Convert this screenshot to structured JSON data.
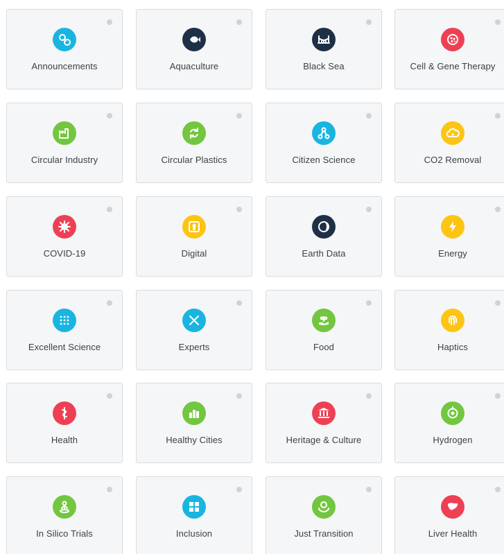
{
  "tiles": [
    {
      "label": "Announcements",
      "icon": "link-chain-icon",
      "color": "#19b5e0"
    },
    {
      "label": "Aquaculture",
      "icon": "fish-icon",
      "color": "#1e3046"
    },
    {
      "label": "Black Sea",
      "icon": "bridge-icon",
      "color": "#1e3046"
    },
    {
      "label": "Cell & Gene Therapy",
      "icon": "cell-icon",
      "color": "#ee4054"
    },
    {
      "label": "Circular Industry",
      "icon": "factory-icon",
      "color": "#73c63f"
    },
    {
      "label": "Circular Plastics",
      "icon": "recycle-icon",
      "color": "#73c63f"
    },
    {
      "label": "Citizen Science",
      "icon": "network-icon",
      "color": "#19b5e0"
    },
    {
      "label": "CO2 Removal",
      "icon": "cloud-co2-icon",
      "color": "#fdc513"
    },
    {
      "label": "COVID-19",
      "icon": "virus-icon",
      "color": "#ee4054"
    },
    {
      "label": "Digital",
      "icon": "keyhole-icon",
      "color": "#fdc513"
    },
    {
      "label": "Earth Data",
      "icon": "earth-icon",
      "color": "#1e3046"
    },
    {
      "label": "Energy",
      "icon": "lightning-icon",
      "color": "#fdc513"
    },
    {
      "label": "Excellent Science",
      "icon": "dots-grid-icon",
      "color": "#19b5e0"
    },
    {
      "label": "Experts",
      "icon": "tools-icon",
      "color": "#19b5e0"
    },
    {
      "label": "Food",
      "icon": "plant-hand-icon",
      "color": "#73c63f"
    },
    {
      "label": "Haptics",
      "icon": "fingerprint-icon",
      "color": "#fdc513"
    },
    {
      "label": "Health",
      "icon": "caduceus-icon",
      "color": "#ee4054"
    },
    {
      "label": "Healthy Cities",
      "icon": "city-icon",
      "color": "#73c63f"
    },
    {
      "label": "Heritage & Culture",
      "icon": "museum-icon",
      "color": "#ee4054"
    },
    {
      "label": "Hydrogen",
      "icon": "atom-target-icon",
      "color": "#73c63f"
    },
    {
      "label": "In Silico Trials",
      "icon": "person-pin-icon",
      "color": "#73c63f"
    },
    {
      "label": "Inclusion",
      "icon": "puzzle-icon",
      "color": "#19b5e0"
    },
    {
      "label": "Just Transition",
      "icon": "globe-hands-icon",
      "color": "#73c63f"
    },
    {
      "label": "Liver Health",
      "icon": "liver-icon",
      "color": "#ee4054"
    }
  ]
}
